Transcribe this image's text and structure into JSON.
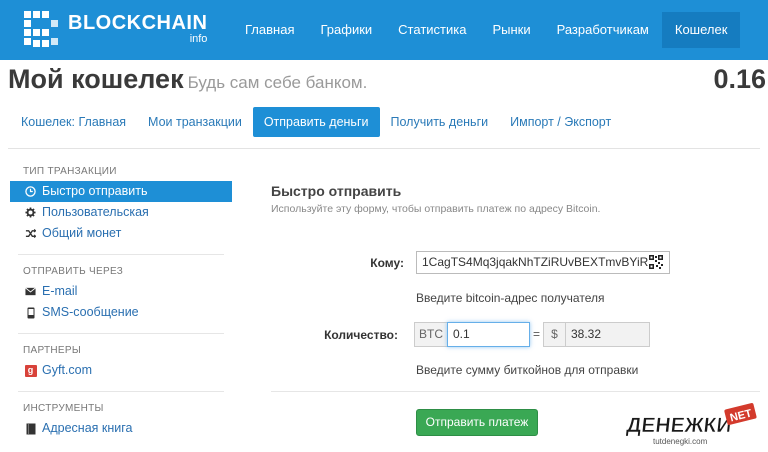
{
  "brand": {
    "title": "BLOCKCHAIN",
    "subtitle": "info"
  },
  "nav": [
    {
      "label": "Главная"
    },
    {
      "label": "Графики"
    },
    {
      "label": "Статистика"
    },
    {
      "label": "Рынки"
    },
    {
      "label": "Разработчикам"
    },
    {
      "label": "Кошелек",
      "active": true
    }
  ],
  "header": {
    "title": "Мой кошелек",
    "subtitle": "Будь сам себе банком.",
    "balance": "0.16"
  },
  "subnav": [
    {
      "label": "Кошелек: Главная"
    },
    {
      "label": "Мои транзакции"
    },
    {
      "label": "Отправить деньги",
      "active": true
    },
    {
      "label": "Получить деньги"
    },
    {
      "label": "Импорт / Экспорт"
    }
  ],
  "sidebar": {
    "tx_type_heading": "ТИП ТРАНЗАКЦИИ",
    "quick_send": "Быстро отправить",
    "custom": "Пользовательская",
    "shared_coin": "Общий монет",
    "send_via_heading": "ОТПРАВИТЬ ЧЕРЕЗ",
    "email": "E-mail",
    "sms": "SMS-сообщение",
    "partners_heading": "ПАРТНЕРЫ",
    "gyft": "Gyft.com",
    "tools_heading": "ИНСТРУМЕНТЫ",
    "address_book": "Адресная книга"
  },
  "form": {
    "title": "Быстро отправить",
    "description": "Используйте эту форму, чтобы отправить платеж по адресу Bitcoin.",
    "to_label": "Кому:",
    "to_value": "1CagTS4Mq3jqakNhTZiRUvBEXTmvBYiR",
    "to_hint": "Введите bitcoin-адрес получателя",
    "amount_label": "Количество:",
    "btc_unit": "BTC",
    "btc_value": "0.1",
    "equals": "=",
    "usd_unit": "$",
    "usd_value": "38.32",
    "amount_hint": "Введите сумму биткойнов для отправки",
    "send_button": "Отправить платеж"
  },
  "watermark": {
    "text": "ДЕНЕЖКИ",
    "badge": "NET",
    "url": "tutdenegki.com"
  },
  "colors": {
    "brand_blue": "#1e8fd6",
    "send_green": "#3aa854",
    "link_blue": "#2a6fb0"
  }
}
